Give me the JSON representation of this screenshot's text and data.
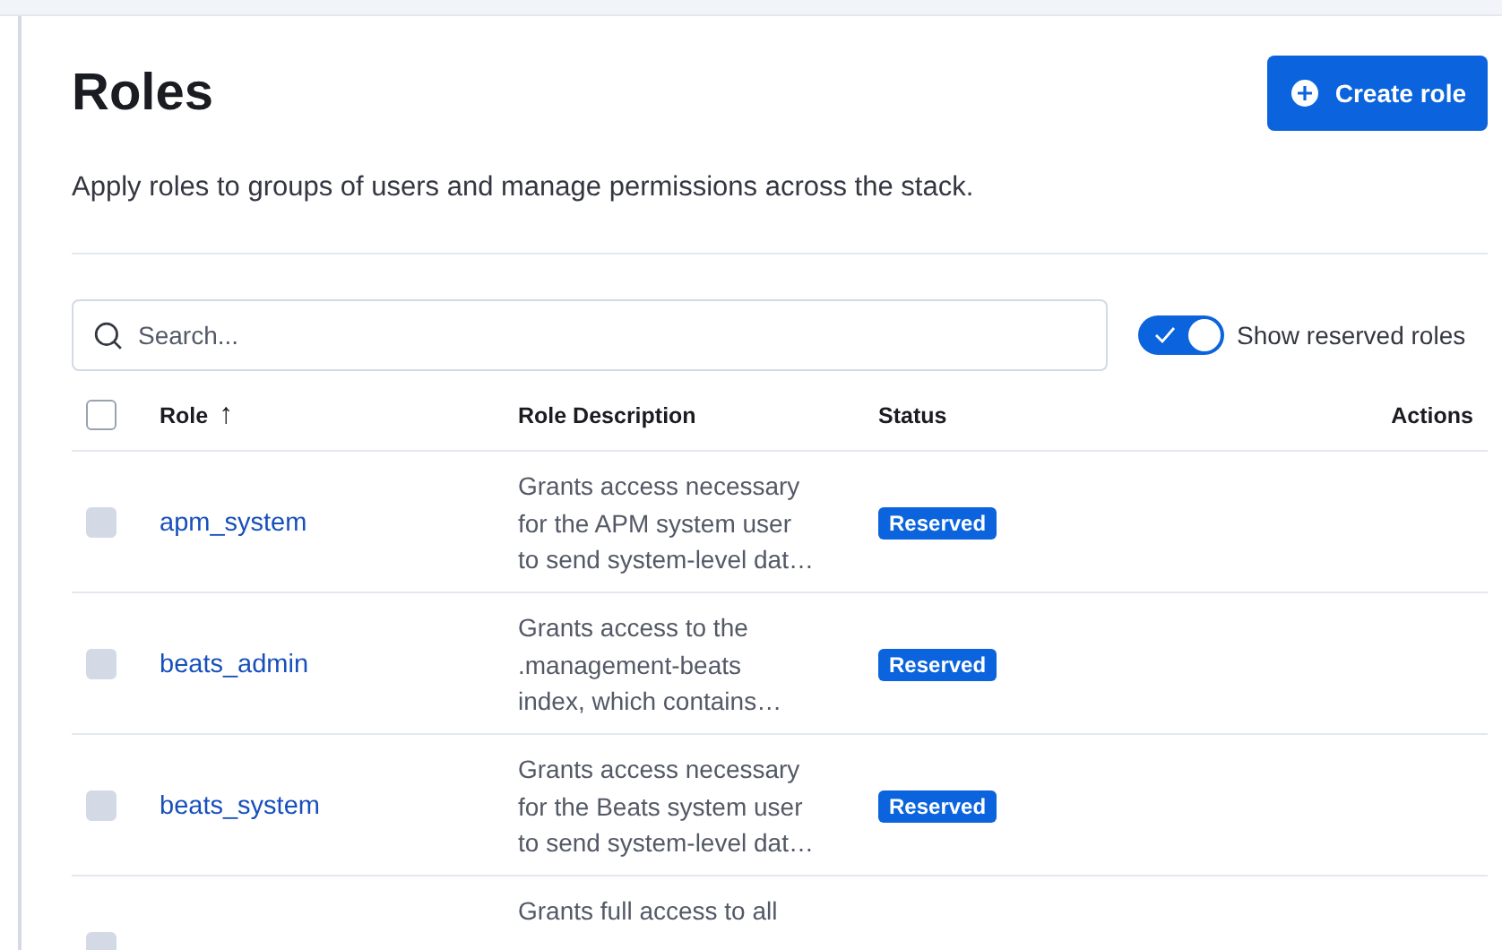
{
  "page": {
    "title": "Roles",
    "description": "Apply roles to groups of users and manage permissions across the stack."
  },
  "create_button": {
    "label": "Create role"
  },
  "search": {
    "placeholder": "Search..."
  },
  "reserved_toggle": {
    "label": "Show reserved roles",
    "on": true
  },
  "table": {
    "select_all": {
      "checked": false
    },
    "columns": [
      {
        "label": "Role",
        "sort": "↑"
      },
      {
        "label": "Role Description"
      },
      {
        "label": "Status"
      },
      {
        "label": "Actions"
      }
    ],
    "rows": [
      {
        "role": "apm_system",
        "disabled": true,
        "description": [
          "Grants access necessary",
          "for the APM system user",
          "to send system-level dat…"
        ],
        "status": "Reserved"
      },
      {
        "role": "beats_admin",
        "disabled": true,
        "description": [
          "Grants access to the",
          ".management-beats",
          "index, which contains…"
        ],
        "status": "Reserved"
      },
      {
        "role": "beats_system",
        "disabled": true,
        "description": [
          "Grants access necessary",
          "for the Beats system user",
          "to send system-level dat…"
        ],
        "status": "Reserved"
      },
      {
        "disabled": true,
        "description": [
          "Grants full access to all"
        ]
      }
    ]
  }
}
